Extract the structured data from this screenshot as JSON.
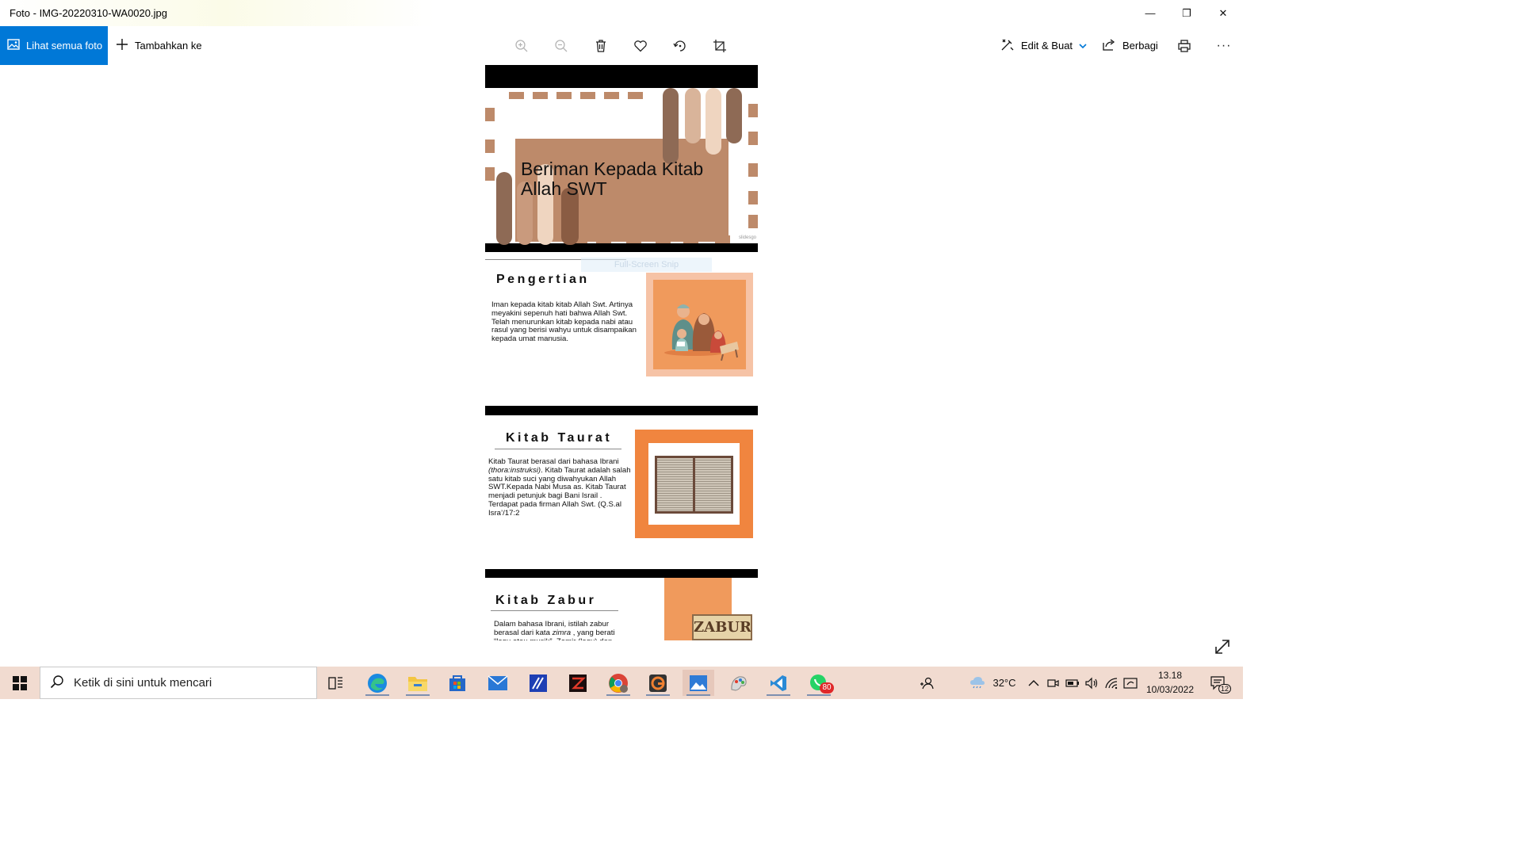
{
  "window": {
    "title": "Foto - IMG-20220310-WA0020.jpg",
    "minimize_glyph": "—",
    "restore_glyph": "❐",
    "close_glyph": "✕"
  },
  "toolbar": {
    "view_all_label": "Lihat semua foto",
    "add_to_label": "Tambahkan ke",
    "edit_create_label": "Edit & Buat",
    "share_label": "Berbagi",
    "more_glyph": "···",
    "icons": [
      "zoom-in-icon",
      "zoom-out-icon",
      "delete-icon",
      "heart-icon",
      "rotate-icon",
      "crop-icon",
      "print-icon"
    ]
  },
  "photo": {
    "slide1": {
      "title": "Beriman Kepada Kitab Allah SWT",
      "watermark": "slidesgo"
    },
    "snip_overlay": "Full-Screen Snip",
    "slide2": {
      "title": "Pengertian",
      "body": "Iman kepada kitab kitab Allah Swt. Artinya meyakini sepenuh hati bahwa Allah Swt. Telah menurunkan kitab kepada nabi atau rasul yang berisi wahyu untuk disampaikan kepada umat manusia."
    },
    "slide3": {
      "title": "Kitab Taurat",
      "body_pre": "Kitab Taurat berasal dari bahasa Ibrani ",
      "body_italic": "(thora:instruksi)",
      "body_post": ". Kitab Taurat adalah salah satu kitab suci yang diwahyukan Allah SWT.Kepada Nabi Musa as. Kitab Taurat menjadi petunjuk bagi Bani Israil . Terdapat pada firman Allah Swt. (Q.S.al Isra’/17:2"
    },
    "slide4": {
      "title": "Kitab Zabur",
      "body_pre": "Dalam bahasa Ibrani, istilah zabur berasal dari kata ",
      "body_italic": "zimra",
      "body_post": " , yang berati “lagu atau musik”. Zamir (lagu) dan",
      "badge": "ZABUR"
    }
  },
  "taskbar": {
    "search_placeholder": "Ketik di sini untuk mencari",
    "whatsapp_badge": "80",
    "temperature": "32°C",
    "time": "13.18",
    "date": "10/03/2022",
    "notification_count": "12"
  },
  "colors": {
    "accent": "#0078d7",
    "taskbar": "#f1dbd0",
    "slide_brown": "#bd8a6a",
    "slide_orange": "#f0853f",
    "slide_light_orange": "#f09a5c"
  }
}
